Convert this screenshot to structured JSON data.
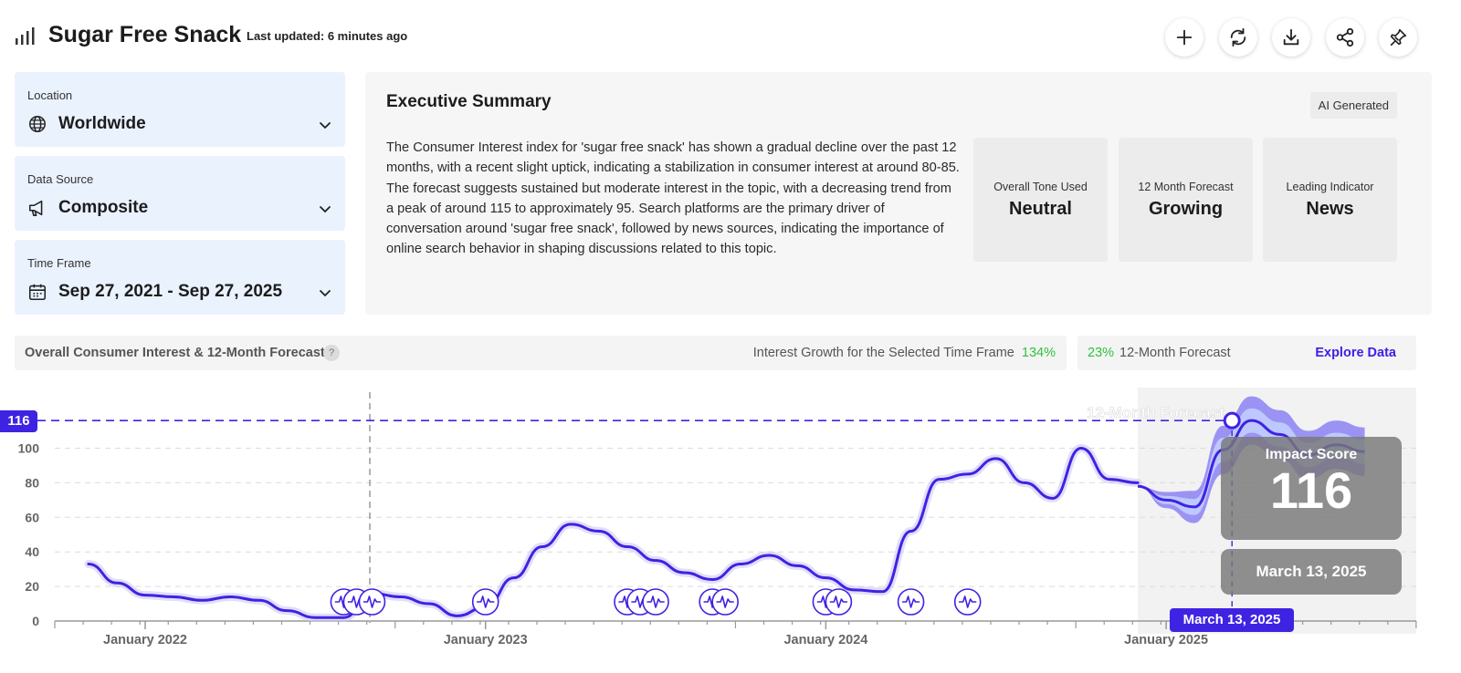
{
  "header": {
    "title": "Sugar Free Snack",
    "last_updated": "Last updated: 6 minutes ago",
    "actions": [
      "plus-icon",
      "refresh-icon",
      "download-icon",
      "share-icon",
      "pin-icon"
    ]
  },
  "filters": {
    "location": {
      "label": "Location",
      "value": "Worldwide"
    },
    "data_source": {
      "label": "Data Source",
      "value": "Composite"
    },
    "time_frame": {
      "label": "Time Frame",
      "value": "Sep 27, 2021 - Sep 27, 2025"
    }
  },
  "summary": {
    "title": "Executive Summary",
    "badge": "AI Generated",
    "text": "The Consumer Interest index for 'sugar free snack' has shown a gradual decline over the past 12 months, with a recent slight uptick, indicating a stabilization in consumer interest at around 80-85. The forecast suggests sustained but moderate interest in the topic, with a decreasing trend from a peak of around 115 to approximately 95. Search platforms are the primary driver of conversation around 'sugar free snack', followed by news sources, indicating the importance of online search behavior in shaping discussions related to this topic.",
    "metrics": [
      {
        "label": "Overall Tone Used",
        "value": "Neutral"
      },
      {
        "label": "12 Month Forecast",
        "value": "Growing"
      },
      {
        "label": "Leading Indicator",
        "value": "News"
      }
    ]
  },
  "chart_header": {
    "title": "Overall Consumer Interest & 12-Month Forecast",
    "help": "?",
    "growth_label": "Interest Growth for the Selected Time Frame",
    "growth_value": "134%",
    "forecast_value": "23%",
    "forecast_label": "12-Month Forecast",
    "explore": "Explore Data"
  },
  "colors": {
    "accent": "#3f23e2",
    "positive": "#2ec23c",
    "filter_bg": "#eaf2fe"
  },
  "chart_data": {
    "type": "line",
    "ylim": [
      0,
      116
    ],
    "yticks": [
      "0",
      "20",
      "40",
      "60",
      "80",
      "100"
    ],
    "xticks": [
      "January 2022",
      "January 2023",
      "January 2024",
      "January 2025"
    ],
    "forecast_label": "12-Month Forecast",
    "series": [
      {
        "values_note": "",
        "x": [
          "2021-11",
          "2021-12",
          "2022-01",
          "2022-02",
          "2022-03",
          "2022-04",
          "2022-05",
          "2022-06",
          "2022-07",
          "2022-08",
          "2022-09",
          "2022-10",
          "2022-11",
          "2022-12",
          "2023-01",
          "2023-02",
          "2023-03",
          "2023-04",
          "2023-05",
          "2023-06",
          "2023-07",
          "2023-08",
          "2023-09",
          "2023-10",
          "2023-11",
          "2023-12",
          "2024-01",
          "2024-02",
          "2024-03",
          "2024-04",
          "2024-05",
          "2024-06",
          "2024-07",
          "2024-08",
          "2024-09",
          "2024-10"
        ],
        "values": [
          33,
          22,
          15,
          14,
          12,
          14,
          12,
          6,
          2,
          2,
          16,
          14,
          10,
          3,
          8,
          25,
          43,
          56,
          52,
          43,
          35,
          28,
          24,
          33,
          38,
          32,
          25,
          18,
          17,
          52,
          82,
          85,
          94,
          80,
          71,
          100
        ]
      }
    ],
    "tail": {
      "x": [
        "2024-11",
        "2024-12"
      ],
      "values": [
        82,
        80
      ]
    },
    "forecast": {
      "x": [
        "2024-12",
        "2025-01",
        "2025-02",
        "2025-03",
        "2025-04",
        "2025-05",
        "2025-06",
        "2025-07",
        "2025-08"
      ],
      "values": [
        78,
        70,
        66,
        99,
        116,
        108,
        96,
        102,
        98
      ]
    },
    "event_markers": [
      "2022-08",
      "2022-08",
      "2022-09",
      "2023-01",
      "2023-06",
      "2023-06",
      "2023-07",
      "2023-09",
      "2023-09",
      "2024-01",
      "2024-01",
      "2024-04",
      "2024-06"
    ],
    "reference_line": {
      "value": 116,
      "label": "116"
    },
    "highlight": {
      "x": "2025-03",
      "value": 116,
      "date_label": "March 13, 2025",
      "score_label": "Impact Score",
      "score": "116"
    }
  }
}
